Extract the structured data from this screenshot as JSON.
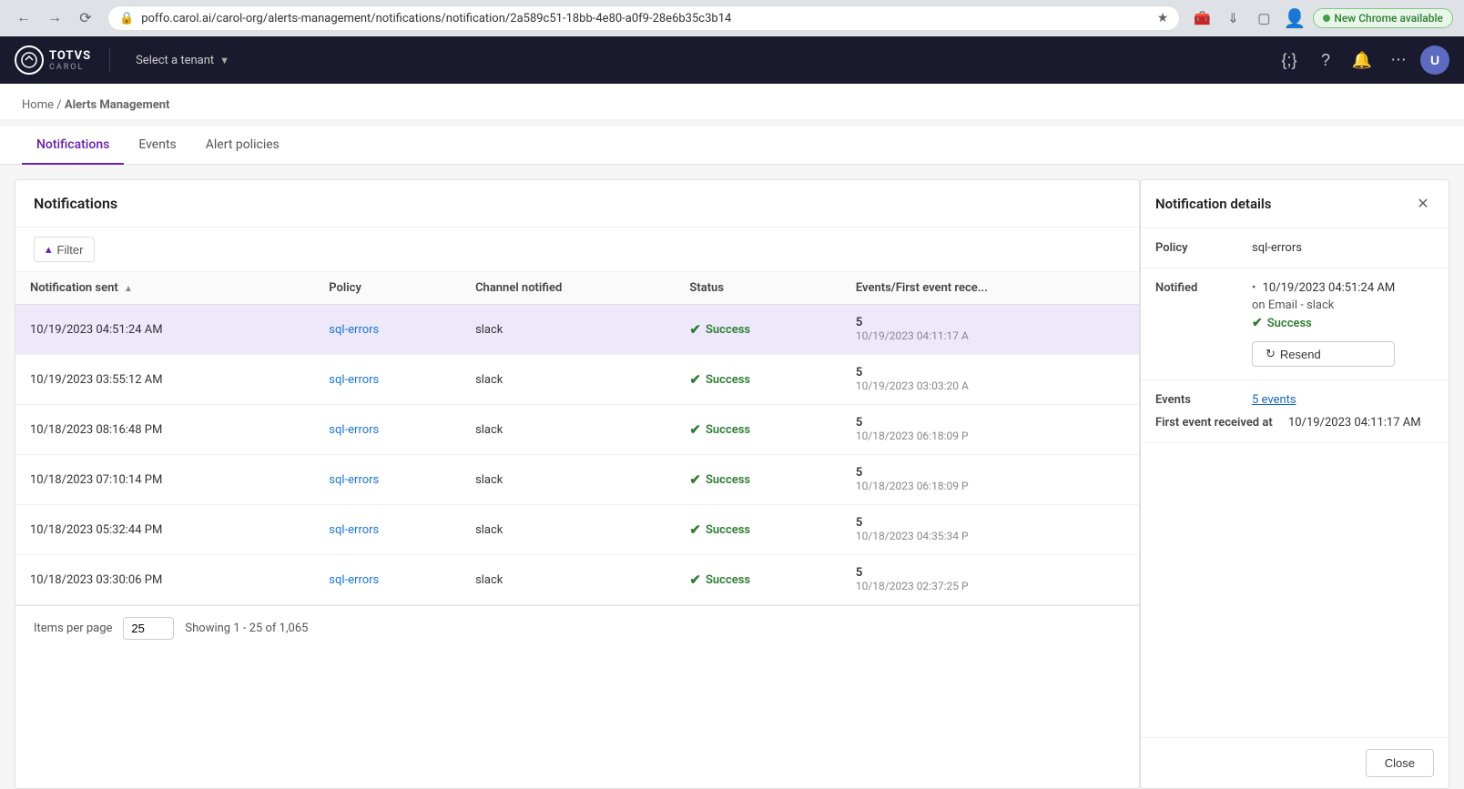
{
  "browser": {
    "url": "poffo.carol.ai/carol-org/alerts-management/notifications/notification/2a589c51-18bb-4e80-a0f9-28e6b35c3b14",
    "new_chrome_label": "New Chrome available",
    "back_title": "Back",
    "forward_title": "Forward",
    "refresh_title": "Refresh"
  },
  "navbar": {
    "logo_text": "TOTVS",
    "logo_sub": "CAROL",
    "tenant_placeholder": "Select a tenant",
    "icons": [
      "code-icon",
      "help-icon",
      "bell-icon",
      "apps-icon",
      "profile-icon"
    ]
  },
  "breadcrumb": {
    "home": "Home",
    "separator": "/",
    "current": "Alerts Management"
  },
  "tabs": [
    {
      "id": "notifications",
      "label": "Notifications",
      "active": true
    },
    {
      "id": "events",
      "label": "Events",
      "active": false
    },
    {
      "id": "alert-policies",
      "label": "Alert policies",
      "active": false
    }
  ],
  "table_section": {
    "title": "Notifications",
    "filter_label": "Filter",
    "columns": [
      {
        "id": "notification_sent",
        "label": "Notification sent",
        "sortable": true,
        "sort_dir": "asc"
      },
      {
        "id": "policy",
        "label": "Policy"
      },
      {
        "id": "channel_notified",
        "label": "Channel notified"
      },
      {
        "id": "status",
        "label": "Status"
      },
      {
        "id": "events_first",
        "label": "Events/First event rece..."
      }
    ],
    "rows": [
      {
        "id": "row1",
        "notification_sent": "10/19/2023 04:51:24 AM",
        "policy": "sql-errors",
        "channel": "slack",
        "status": "Success",
        "events_count": "5",
        "first_event": "10/19/2023 04:11:17 A",
        "selected": true
      },
      {
        "id": "row2",
        "notification_sent": "10/19/2023 03:55:12 AM",
        "policy": "sql-errors",
        "channel": "slack",
        "status": "Success",
        "events_count": "5",
        "first_event": "10/19/2023 03:03:20 A",
        "selected": false
      },
      {
        "id": "row3",
        "notification_sent": "10/18/2023 08:16:48 PM",
        "policy": "sql-errors",
        "channel": "slack",
        "status": "Success",
        "events_count": "5",
        "first_event": "10/18/2023 06:18:09 P",
        "selected": false
      },
      {
        "id": "row4",
        "notification_sent": "10/18/2023 07:10:14 PM",
        "policy": "sql-errors",
        "channel": "slack",
        "status": "Success",
        "events_count": "5",
        "first_event": "10/18/2023 06:18:09 P",
        "selected": false
      },
      {
        "id": "row5",
        "notification_sent": "10/18/2023 05:32:44 PM",
        "policy": "sql-errors",
        "channel": "slack",
        "status": "Success",
        "events_count": "5",
        "first_event": "10/18/2023 04:35:34 P",
        "selected": false
      },
      {
        "id": "row6",
        "notification_sent": "10/18/2023 03:30:06 PM",
        "policy": "sql-errors",
        "channel": "slack",
        "status": "Success",
        "events_count": "5",
        "first_event": "10/18/2023 02:37:25 P",
        "selected": false
      }
    ],
    "pagination": {
      "items_per_page_label": "Items per page",
      "items_per_page_value": "25",
      "showing_text": "Showing 1 - 25 of 1,065"
    }
  },
  "side_panel": {
    "title": "Notification details",
    "policy_label": "Policy",
    "policy_value": "sql-errors",
    "notified_label": "Notified",
    "notified_date": "10/19/2023 04:51:24 AM",
    "notified_channel": "on Email - slack",
    "notified_status": "Success",
    "resend_label": "Resend",
    "events_label": "Events",
    "events_value": "5 events",
    "first_event_label": "First event received at",
    "first_event_value": "10/19/2023 04:11:17 AM",
    "close_label": "Close"
  },
  "colors": {
    "accent": "#6b21a8",
    "success": "#2e7d32",
    "link": "#1976d2",
    "selected_row_bg": "#ede9fb",
    "navbar_bg": "#1a1a2e"
  }
}
